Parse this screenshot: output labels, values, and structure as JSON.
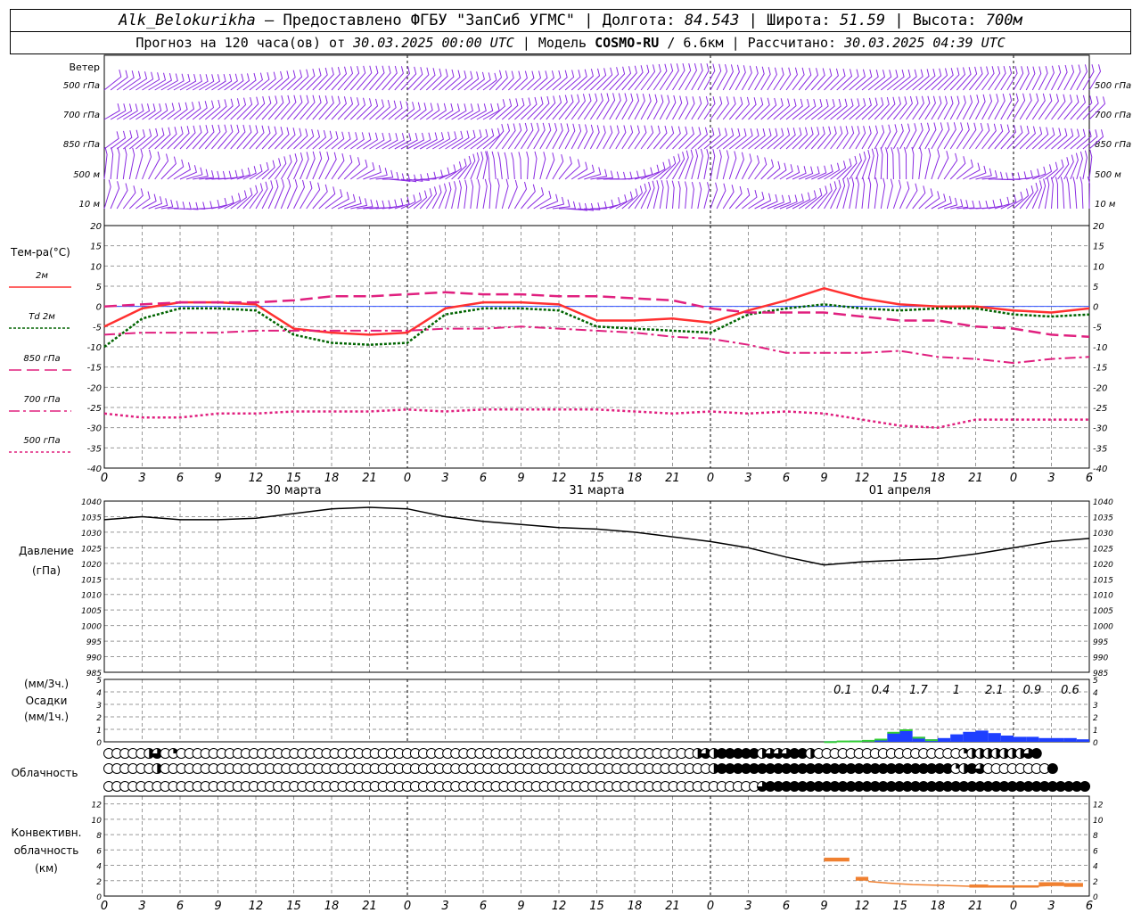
{
  "header": {
    "station": "Alk_Belokurikha",
    "provider": "– Предоставлено ФГБУ \"ЗапСиб УГМС\"",
    "lon_label": "| Долгота:",
    "lon_value": "84.543",
    "lat_label": "| Широта:",
    "lat_value": "51.59",
    "alt_label": "| Высота:",
    "alt_value": "700м",
    "forecast_prefix": "Прогноз на 120 часа(ов) от",
    "forecast_start": "30.03.2025 00:00 UTC",
    "model_label": "| Модель",
    "model_name": "COSMO-RU",
    "model_res": "/ 6.6км",
    "calc_label": "| Рассчитано:",
    "calc_time": "30.03.2025 04:39 UTC"
  },
  "colors": {
    "wind": "#8a2be2",
    "t2m": "#ff3030",
    "td2m": "#006400",
    "t850": "#e0207f",
    "pressure": "#000000",
    "precip3h": "#1e3fff",
    "precip1h": "#32cd32",
    "convective": "#f08030",
    "grid": "#999999"
  },
  "chart_data": [
    {
      "type": "wind_barbs",
      "title": "Ветер",
      "levels": [
        "500 гПа",
        "700 гПа",
        "850 гПа",
        "500 м",
        "10 м"
      ]
    },
    {
      "type": "line",
      "ylabel": "Тем-ра(°С)",
      "ylim": [
        -40,
        20
      ],
      "yticks": [
        20,
        15,
        10,
        5,
        0,
        -5,
        -10,
        -15,
        -20,
        -25,
        -30,
        -35,
        -40
      ],
      "x_hours": [
        0,
        3,
        6,
        9,
        12,
        15,
        18,
        21,
        24,
        27,
        30,
        33,
        36,
        39,
        42,
        45,
        48,
        51,
        54,
        57,
        60,
        63,
        66,
        69,
        72,
        75,
        78
      ],
      "xticklabels": [
        "0",
        "3",
        "6",
        "9",
        "12",
        "15",
        "18",
        "21",
        "0",
        "3",
        "6",
        "9",
        "12",
        "15",
        "18",
        "21",
        "0",
        "3",
        "6",
        "9",
        "12",
        "15",
        "18",
        "21",
        "0",
        "3",
        "6"
      ],
      "day_labels": [
        "30 марта",
        "31 марта",
        "01 апреля"
      ],
      "series": [
        {
          "name": "2м",
          "values": [
            -5,
            -0.5,
            1,
            1,
            0.5,
            -5.5,
            -6.5,
            -7,
            -6.5,
            -0.5,
            1,
            1,
            0.5,
            -3.5,
            -3.5,
            -3,
            -4,
            -1,
            1.5,
            4.5,
            2,
            0.5,
            0,
            0,
            -1,
            -1.5,
            -0.5
          ]
        },
        {
          "name": "Td 2м",
          "values": [
            -10,
            -3,
            -0.5,
            -0.5,
            -1,
            -7,
            -9,
            -9.5,
            -9,
            -2,
            -0.5,
            -0.5,
            -1,
            -5,
            -5.5,
            -6,
            -6.5,
            -2,
            -0.5,
            0.5,
            -0.5,
            -1,
            -0.5,
            -0.5,
            -2,
            -2.5,
            -2
          ]
        },
        {
          "name": "850 гПа",
          "values": [
            0,
            0.5,
            1,
            1,
            1,
            1.5,
            2.5,
            2.5,
            3,
            3.5,
            3,
            3,
            2.5,
            2.5,
            2,
            1.5,
            -0.5,
            -1.5,
            -1.5,
            -1.5,
            -2.5,
            -3.5,
            -3.5,
            -5,
            -5.5,
            -7,
            -7.5
          ]
        },
        {
          "name": "700 гПа",
          "values": [
            -7,
            -6.5,
            -6.5,
            -6.5,
            -6,
            -6,
            -6,
            -6,
            -6,
            -5.5,
            -5.5,
            -5,
            -5.5,
            -6,
            -6.5,
            -7.5,
            -8,
            -9.5,
            -11.5,
            -11.5,
            -11.5,
            -11,
            -12.5,
            -13,
            -14,
            -13,
            -12.5
          ]
        },
        {
          "name": "500 гПа",
          "values": [
            -26.5,
            -27.5,
            -27.5,
            -26.5,
            -26.5,
            -26,
            -26,
            -26,
            -25.5,
            -26,
            -25.5,
            -25.5,
            -25.5,
            -25.5,
            -26,
            -26.5,
            -26,
            -26.5,
            -26,
            -26.5,
            -28,
            -29.5,
            -30,
            -28,
            -28,
            -28,
            -28
          ]
        }
      ]
    },
    {
      "type": "line",
      "ylabel": "Давление",
      "yunit": "(гПа)",
      "ylim": [
        985,
        1040
      ],
      "yticks": [
        1040,
        1035,
        1030,
        1025,
        1020,
        1015,
        1010,
        1005,
        1000,
        995,
        990,
        985
      ],
      "series": [
        {
          "name": "Давление",
          "values": [
            1034,
            1035,
            1034,
            1034,
            1034.5,
            1036,
            1037.5,
            1038,
            1037.5,
            1035,
            1033.5,
            1032.5,
            1031.5,
            1031,
            1030,
            1028.5,
            1027,
            1025,
            1022,
            1019.5,
            1020.5,
            1021,
            1021.5,
            1023,
            1025,
            1027,
            1028
          ]
        }
      ]
    },
    {
      "type": "bar",
      "ylabel_3h": "(мм/3ч.)",
      "ylabel": "Осадки",
      "ylabel_1h": "(мм/1ч.)",
      "ylim": [
        0,
        5
      ],
      "yticks": [
        5,
        4,
        3,
        2,
        1,
        0
      ],
      "totals_3h": [
        {
          "hour": 57,
          "label": "0.1"
        },
        {
          "hour": 60,
          "label": "0.4"
        },
        {
          "hour": 63,
          "label": "1.7"
        },
        {
          "hour": 66,
          "label": "1"
        },
        {
          "hour": 69,
          "label": "2.1"
        },
        {
          "hour": 72,
          "label": "0.9"
        },
        {
          "hour": 75,
          "label": "0.6"
        }
      ],
      "series": [
        {
          "name": "3ч",
          "x": [
            57,
            58,
            59,
            60,
            61,
            62,
            63,
            64,
            65,
            66,
            67,
            68,
            69,
            70,
            71,
            72,
            73,
            74,
            75,
            76,
            77
          ],
          "values": [
            0.05,
            0.05,
            0.1,
            0.1,
            0.2,
            0.7,
            0.9,
            0.4,
            0.2,
            0.3,
            0.6,
            0.8,
            0.9,
            0.7,
            0.5,
            0.4,
            0.4,
            0.3,
            0.3,
            0.3,
            0.2
          ]
        },
        {
          "name": "1ч",
          "x": [
            57,
            58,
            59,
            60,
            61,
            62,
            63,
            64,
            65
          ],
          "values": [
            0.05,
            0.1,
            0.1,
            0.15,
            0.25,
            0.8,
            1,
            0.4,
            0.2
          ]
        }
      ]
    },
    {
      "type": "cloud_cover",
      "ylabel": "Облачность",
      "rows": [
        {
          "level": "upper",
          "cover": [
            0,
            0,
            0,
            0,
            0,
            0.5,
            0.75,
            0,
            0.25,
            0,
            0,
            0,
            0,
            0,
            0,
            0,
            0,
            0,
            0,
            0,
            0,
            0,
            0,
            0,
            0,
            0,
            0,
            0,
            0,
            0,
            0,
            0,
            0,
            0,
            0,
            0,
            0,
            0,
            0,
            0,
            0,
            0,
            0,
            0,
            0,
            0,
            0,
            0,
            0,
            0,
            0,
            0,
            0,
            0,
            0,
            0,
            0,
            0,
            0,
            0,
            0,
            0,
            0,
            0,
            0,
            0,
            0,
            0,
            0,
            0,
            0,
            0,
            0,
            0.5,
            0.75,
            0.5,
            1,
            1,
            1,
            1,
            1,
            0.5,
            0.75,
            0.75,
            0.75,
            1,
            1,
            0.5,
            0,
            0,
            0,
            0,
            0,
            0,
            0,
            0,
            0,
            0,
            0,
            0,
            0,
            0,
            0,
            0,
            0,
            0,
            0.25,
            0.5,
            0.5,
            0.5,
            0.5,
            0.5,
            0.5,
            0.5,
            0.75,
            1
          ]
        },
        {
          "level": "middle",
          "cover": [
            0,
            0,
            0,
            0,
            0,
            0,
            0.5,
            0,
            0,
            0,
            0,
            0,
            0,
            0,
            0,
            0,
            0,
            0,
            0,
            0,
            0,
            0,
            0,
            0,
            0,
            0,
            0,
            0,
            0,
            0,
            0,
            0,
            0,
            0,
            0,
            0,
            0,
            0,
            0,
            0,
            0,
            0,
            0,
            0,
            0,
            0,
            0,
            0,
            0,
            0,
            0,
            0,
            0,
            0,
            0,
            0,
            0,
            0,
            0,
            0,
            0,
            0,
            0,
            0,
            0,
            0,
            0,
            0,
            0,
            0,
            0,
            0,
            0,
            0,
            0,
            0.5,
            1,
            1,
            1,
            1,
            1,
            1,
            1,
            1,
            1,
            1,
            1,
            1,
            1,
            1,
            1,
            1,
            1,
            1,
            1,
            1,
            1,
            1,
            1,
            1,
            1,
            1,
            1,
            1,
            1,
            0.25,
            0.5,
            1,
            0.75,
            0,
            0,
            0,
            0,
            0,
            0,
            0,
            0,
            1
          ]
        },
        {
          "level": "lower",
          "cover": [
            0,
            0,
            0,
            0,
            0,
            0,
            0,
            0,
            0,
            0,
            0,
            0,
            0,
            0,
            0,
            0,
            0,
            0,
            0,
            0,
            0,
            0,
            0,
            0,
            0,
            0,
            0,
            0,
            0,
            0,
            0,
            0,
            0,
            0,
            0,
            0,
            0,
            0,
            0,
            0,
            0,
            0,
            0,
            0,
            0,
            0,
            0,
            0,
            0,
            0,
            0,
            0,
            0,
            0,
            0,
            0,
            0,
            0,
            0,
            0,
            0,
            0,
            0,
            0,
            0,
            0,
            0,
            0,
            0,
            0,
            0,
            0,
            0,
            0,
            0,
            0,
            0,
            0,
            0,
            0,
            0,
            0.75,
            1,
            1,
            1,
            1,
            1,
            1,
            1,
            1,
            1,
            1,
            1,
            1,
            1,
            1,
            1,
            1,
            1,
            1,
            1,
            1,
            1,
            1,
            1,
            1,
            1,
            1,
            1,
            1,
            1,
            1,
            1,
            1,
            1,
            1,
            1,
            1,
            1,
            1,
            1,
            1
          ]
        }
      ]
    },
    {
      "type": "bar",
      "ylabel": "Конвективн.",
      "ylabel2": "облачность",
      "yunit": "(км)",
      "ylim": [
        0,
        13
      ],
      "yticks": [
        12,
        10,
        8,
        6,
        4,
        2,
        0
      ],
      "segments": [
        {
          "from": 57,
          "to": 59,
          "base": 4.5,
          "top": 5
        },
        {
          "from": 59.5,
          "to": 60.5,
          "base": 2,
          "top": 2.5
        },
        {
          "from": 68.5,
          "to": 70,
          "base": 1.1,
          "top": 1.5
        },
        {
          "from": 70,
          "to": 74,
          "base": 1.1,
          "top": 1.4
        },
        {
          "from": 74,
          "to": 76,
          "base": 1.3,
          "top": 1.8
        },
        {
          "from": 76,
          "to": 77.5,
          "base": 1.2,
          "top": 1.7
        }
      ],
      "line": {
        "x": [
          60.5,
          62,
          64,
          66,
          68,
          70,
          72,
          74,
          76,
          77.5
        ],
        "values": [
          1.9,
          1.7,
          1.5,
          1.4,
          1.3,
          1.2,
          1.2,
          1.3,
          1.5,
          1.6
        ]
      }
    }
  ]
}
